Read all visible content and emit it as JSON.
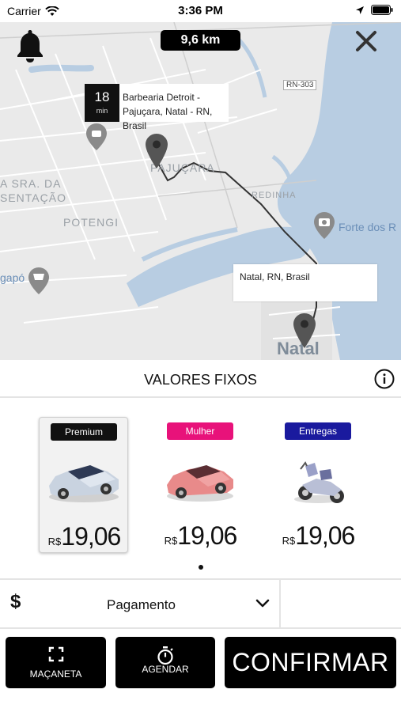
{
  "status_bar": {
    "carrier": "Carrier",
    "time": "3:36 PM"
  },
  "map": {
    "distance": "9,6 km",
    "eta": {
      "value": "18",
      "unit": "min"
    },
    "origin_address": [
      "Barbearia Detroit -",
      "Pajuçara, Natal - RN, Brasil"
    ],
    "destination_address": "Natal, RN, Brasil",
    "labels": {
      "pajucara": "PAJUÇARA",
      "potengi": "POTENGI",
      "sra": "A SRA. DA",
      "sentacao": "SENTAÇÃO",
      "redinha": "REDINHA",
      "forte": "Forte dos R",
      "natal": "Natal",
      "gapo": "gapó",
      "road": "RN-303"
    },
    "colors": {
      "land": "#eaeaea",
      "water": "#b8cde2",
      "route": "#333333"
    }
  },
  "fixed_values": {
    "title": "VALORES FIXOS"
  },
  "categories": [
    {
      "tag": "Premium",
      "tag_color": "#111111",
      "currency": "R$",
      "price": "19,06",
      "vehicle_icon": "sedan-icon",
      "selected": true
    },
    {
      "tag": "Mulher",
      "tag_color": "#e8127a",
      "currency": "R$",
      "price": "19,06",
      "vehicle_icon": "pink-car-icon",
      "selected": false
    },
    {
      "tag": "Entregas",
      "tag_color": "#1a1a9e",
      "currency": "R$",
      "price": "19,06",
      "vehicle_icon": "scooter-icon",
      "selected": false
    }
  ],
  "payment": {
    "icon": "$",
    "label": "Pagamento"
  },
  "actions": {
    "macaneta": "MAÇANETA",
    "agendar": "AGENDAR",
    "confirmar": "CONFIRMAR"
  }
}
